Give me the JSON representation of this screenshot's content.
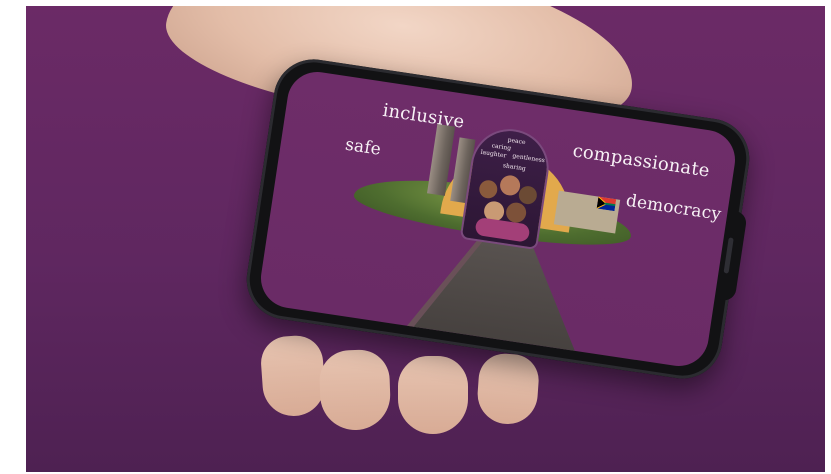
{
  "scene": {
    "colors": {
      "background": "#6b2a66",
      "screen": "#6e2d69",
      "text": "#f7f1f5",
      "accent_gold": "#e2a94c"
    }
  },
  "phone_screen": {
    "words": {
      "inclusive": "inclusive",
      "safe": "safe",
      "compassionate": "compassionate",
      "democracy": "democracy"
    },
    "arch_words": [
      "peace",
      "caring",
      "laughter",
      "gentleness",
      "sharing"
    ]
  }
}
